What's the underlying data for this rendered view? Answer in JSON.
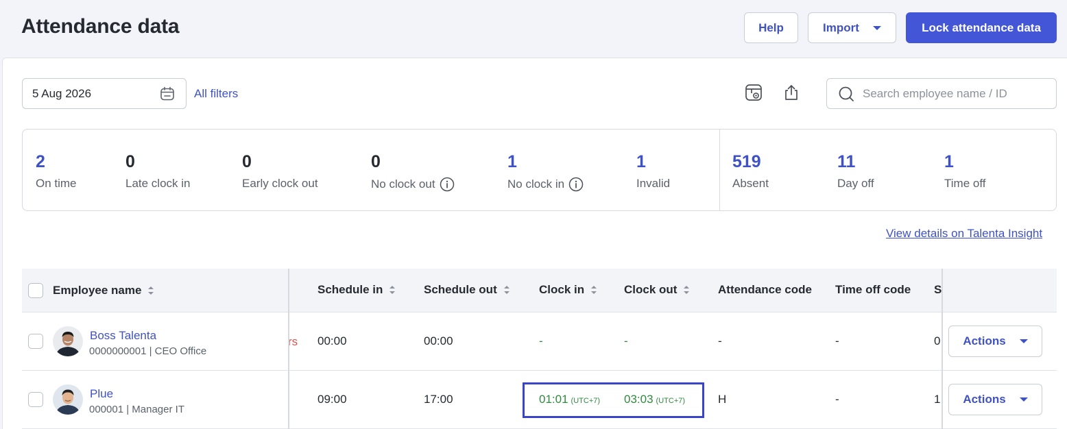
{
  "header": {
    "title": "Attendance data",
    "help_label": "Help",
    "import_label": "Import",
    "lock_label": "Lock attendance data"
  },
  "toolbar": {
    "date_value": "5 Aug 2026",
    "all_filters_label": "All filters",
    "search_placeholder": "Search employee name / ID"
  },
  "summary": {
    "stats": [
      {
        "value": "2",
        "label": "On time",
        "color": "#3f51c6"
      },
      {
        "value": "0",
        "label": "Late clock in",
        "color": "#252a31"
      },
      {
        "value": "0",
        "label": "Early clock out",
        "color": "#252a31"
      },
      {
        "value": "0",
        "label": "No clock out",
        "color": "#252a31",
        "info": true
      },
      {
        "value": "1",
        "label": "No clock in",
        "color": "#3f51c6",
        "info": true
      },
      {
        "value": "1",
        "label": "Invalid",
        "color": "#3f51c6"
      },
      {
        "value": "519",
        "label": "Absent",
        "color": "#3f51c6"
      },
      {
        "value": "11",
        "label": "Day off",
        "color": "#3f51c6"
      },
      {
        "value": "1",
        "label": "Time off",
        "color": "#3f51c6"
      }
    ],
    "insight_link": "View details on Talenta Insight"
  },
  "table": {
    "columns": [
      "Employee name",
      "Schedule in",
      "Schedule out",
      "Clock in",
      "Clock out",
      "Attendance code",
      "Time off code",
      "S"
    ],
    "rows": [
      {
        "name": "Boss Talenta",
        "meta": "0000000001 | CEO Office",
        "cut_text": "rs",
        "schedule_in": "00:00",
        "schedule_out": "00:00",
        "clock_in": "-",
        "clock_in_tz": "",
        "clock_out": "-",
        "clock_out_tz": "",
        "attendance_code": "-",
        "time_off_code": "-",
        "s_partial": "0",
        "actions_label": "Actions"
      },
      {
        "name": "Plue",
        "meta": "000001 | Manager IT",
        "cut_text": "",
        "schedule_in": "09:00",
        "schedule_out": "17:00",
        "clock_in": "01:01",
        "clock_in_tz": "(UTC+7)",
        "clock_out": "03:03",
        "clock_out_tz": "(UTC+7)",
        "attendance_code": "H",
        "time_off_code": "-",
        "s_partial": "1:",
        "actions_label": "Actions"
      }
    ]
  },
  "colors": {
    "accent": "#3f51c6",
    "primary_button": "#4356d8",
    "clock_green": "#2e8b3d",
    "highlight": "#3a44c7"
  }
}
